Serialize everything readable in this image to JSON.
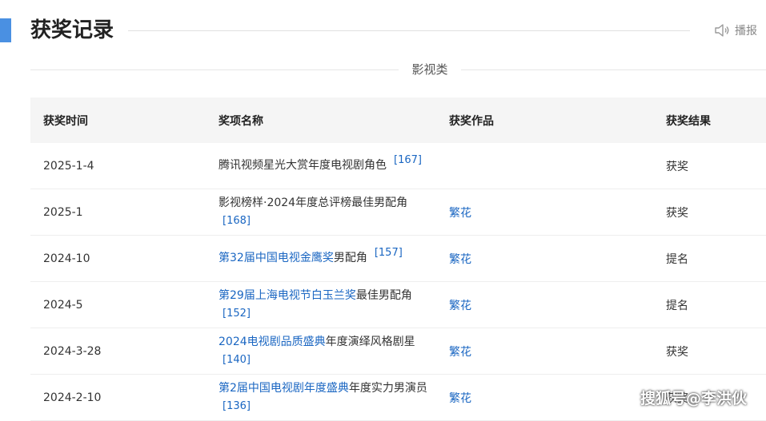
{
  "header": {
    "title": "获奖记录",
    "play_label": "播报"
  },
  "category": "影视类",
  "table": {
    "columns": [
      "获奖时间",
      "奖项名称",
      "获奖作品",
      "获奖结果"
    ],
    "rows": [
      {
        "date": "2025-1-4",
        "award_link": "",
        "award_text": "腾讯视频星光大赏年度电视剧角色",
        "ref": "[167]",
        "ref_style": "sup",
        "work": "",
        "result": "获奖"
      },
      {
        "date": "2025-1",
        "award_link": "",
        "award_text": "影视榜样·2024年度总评榜最佳男配角",
        "ref": "[168]",
        "ref_style": "br",
        "work": "繁花",
        "result": "获奖"
      },
      {
        "date": "2024-10",
        "award_link": "第32届中国电视金鹰奖",
        "award_text": "男配角",
        "ref": "[157]",
        "ref_style": "sup",
        "work": "繁花",
        "result": "提名"
      },
      {
        "date": "2024-5",
        "award_link": "第29届上海电视节白玉兰奖",
        "award_text": "最佳男配角",
        "ref": "[152]",
        "ref_style": "br",
        "work": "繁花",
        "result": "提名"
      },
      {
        "date": "2024-3-28",
        "award_link": "2024电视剧品质盛典",
        "award_text": "年度演绎风格剧星",
        "ref": "[140]",
        "ref_style": "br",
        "work": "繁花",
        "result": "获奖"
      },
      {
        "date": "2024-2-10",
        "award_link": "第2届中国电视剧年度盛典",
        "award_text": "年度实力男演员",
        "ref": "[136]",
        "ref_style": "br",
        "work": "繁花",
        "result": "获奖"
      }
    ]
  },
  "watermark": "搜狐号@李洪伙",
  "colors": {
    "accent": "#4a90e2",
    "link": "#1a66c2",
    "header_bg": "#f5f5f5"
  },
  "icons": {
    "play": "speaker-icon"
  }
}
